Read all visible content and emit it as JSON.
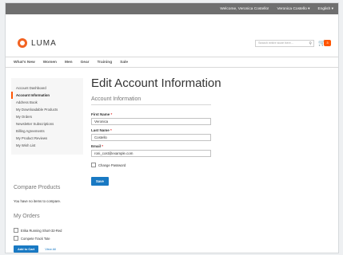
{
  "topbar": {
    "welcome": "Welcome, Veronica Costello!",
    "account": "Veronica Costello ▾",
    "language": "English ▾"
  },
  "header": {
    "logo_text": "LUMA",
    "search_placeholder": "Search entire store here...",
    "cart_count": "3"
  },
  "nav": {
    "items": [
      "What's New",
      "Women",
      "Men",
      "Gear",
      "Training",
      "Sale"
    ]
  },
  "sidebar": {
    "items": [
      {
        "label": "Account Dashboard"
      },
      {
        "label": "Account Information"
      },
      {
        "label": "Address Book"
      },
      {
        "label": "My Downloadable Products"
      },
      {
        "label": "My Orders"
      },
      {
        "label": "Newsletter Subscriptions"
      },
      {
        "label": "Billing Agreements"
      },
      {
        "label": "My Product Reviews"
      },
      {
        "label": "My Wish List"
      }
    ],
    "active_index": 1
  },
  "main": {
    "title": "Edit Account Information",
    "section_title": "Account Information",
    "fields": {
      "first_name_label": "First Name",
      "first_name_value": "Veronica",
      "last_name_label": "Last Name",
      "last_name_value": "Costello",
      "email_label": "Email",
      "email_value": "roni_cost@example.com"
    },
    "change_password_label": "Change Password",
    "save_label": "Save"
  },
  "compare": {
    "title": "Compare Products",
    "empty_text": "You have no items to compare."
  },
  "orders": {
    "title": "My Orders",
    "items": [
      "Erika Running Short-32-Red",
      "Compete Track Tote"
    ],
    "add_to_cart_label": "Add to Cart",
    "view_all_label": "View All"
  },
  "colors": {
    "accent": "#ff5501",
    "primary_button": "#1979c3",
    "topbar": "#6f6f6f"
  }
}
